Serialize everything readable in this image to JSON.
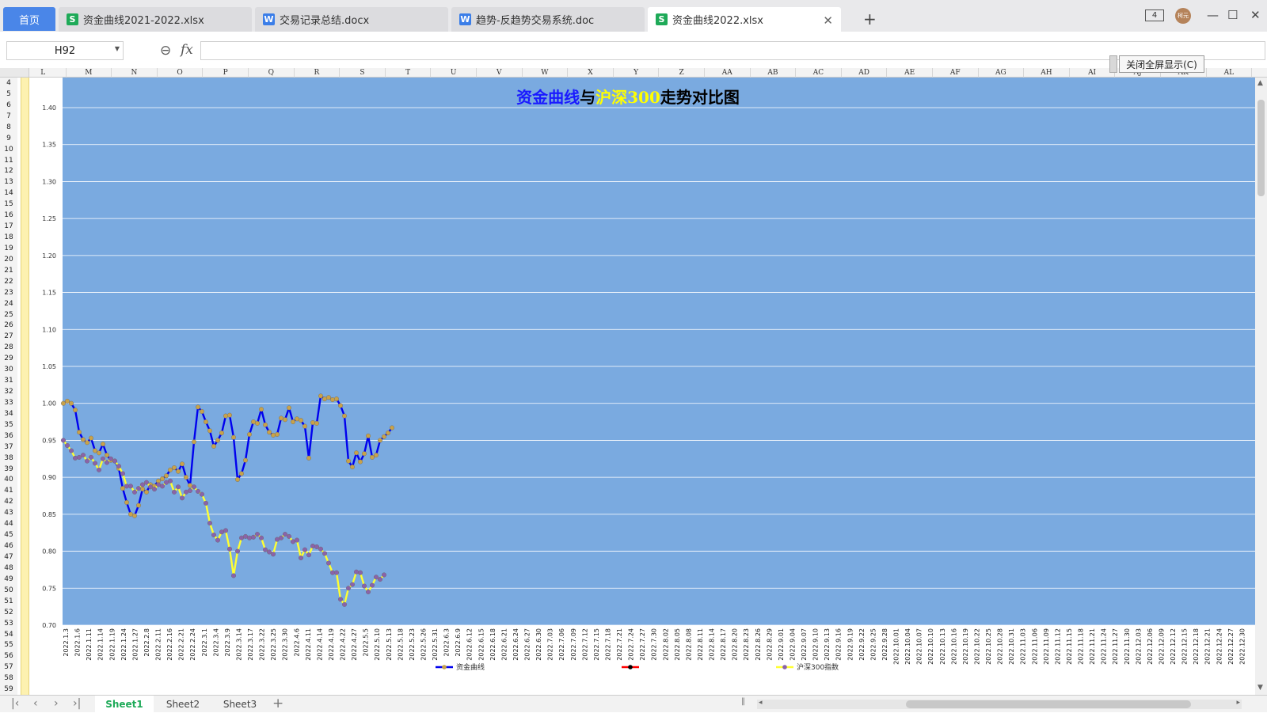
{
  "tabs": {
    "home": "首页",
    "files": [
      {
        "name": "资金曲线2021-2022.xlsx",
        "type": "S"
      },
      {
        "name": "交易记录总结.docx",
        "type": "W"
      },
      {
        "name": "趋势-反趋势交易系统.doc",
        "type": "W"
      },
      {
        "name": "资金曲线2022.xlsx",
        "type": "S"
      }
    ],
    "avatar": "柯元",
    "layout_badge": "4"
  },
  "formula_bar": {
    "cell_ref": "H92",
    "fx": "fx",
    "value": ""
  },
  "columns": [
    "L",
    "M",
    "N",
    "O",
    "P",
    "Q",
    "R",
    "S",
    "T",
    "U",
    "V",
    "W",
    "X",
    "Y",
    "Z",
    "AA",
    "AB",
    "AC",
    "AD",
    "AE",
    "AF",
    "AG",
    "AH",
    "AI",
    "AJ",
    "AK",
    "AL"
  ],
  "rows": [
    "4",
    "5",
    "6",
    "7",
    "8",
    "9",
    "10",
    "11",
    "12",
    "13",
    "14",
    "15",
    "16",
    "17",
    "18",
    "19",
    "20",
    "21",
    "22",
    "23",
    "24",
    "25",
    "26",
    "27",
    "28",
    "29",
    "30",
    "31",
    "32",
    "33",
    "34",
    "35",
    "36",
    "37",
    "38",
    "39",
    "40",
    "41",
    "42",
    "43",
    "44",
    "45",
    "46",
    "47",
    "48",
    "49",
    "50",
    "51",
    "52",
    "53",
    "54",
    "55",
    "56",
    "57",
    "58",
    "59"
  ],
  "fullscreen_button": "关闭全屏显示(C)",
  "sheets": [
    "Sheet1",
    "Sheet2",
    "Sheet3"
  ],
  "active_sheet": "Sheet1",
  "chart_data": {
    "type": "line",
    "title_parts": [
      {
        "text": "资金曲线",
        "color": "#1a1aff"
      },
      {
        "text": "与",
        "color": "#000000"
      },
      {
        "text": "沪深300",
        "color": "#ffff00"
      },
      {
        "text": "走势对比图",
        "color": "#000000"
      }
    ],
    "background": "#7aaae0",
    "ylim": [
      0.7,
      1.4
    ],
    "yticks": [
      "0.70",
      "0.75",
      "0.80",
      "0.85",
      "0.90",
      "0.95",
      "1.00",
      "1.05",
      "1.10",
      "1.15",
      "1.20",
      "1.25",
      "1.30",
      "1.35",
      "1.40"
    ],
    "grid": "horizontal",
    "legend_position": "bottom",
    "categories": [
      "2022.1.3",
      "2022.1.6",
      "2022.1.11",
      "2022.1.14",
      "2022.1.19",
      "2022.1.24",
      "2022.1.27",
      "2022.2.8",
      "2022.2.11",
      "2022.2.16",
      "2022.2.21",
      "2022.2.24",
      "2022.3.1",
      "2022.3.4",
      "2022.3.9",
      "2022.3.14",
      "2022.3.17",
      "2022.3.22",
      "2022.3.25",
      "2022.3.30",
      "2022.4.6",
      "2022.4.11",
      "2022.4.14",
      "2022.4.19",
      "2022.4.22",
      "2022.4.27",
      "2022.5.5",
      "2022.5.10",
      "2022.5.13",
      "2022.5.18",
      "2022.5.23",
      "2022.5.26",
      "2022.5.31",
      "2022.6.3",
      "2022.6.9",
      "2022.6.12",
      "2022.6.15",
      "2022.6.18",
      "2022.6.21",
      "2022.6.24",
      "2022.6.27",
      "2022.6.30",
      "2022.7.03",
      "2022.7.06",
      "2022.7.09",
      "2022.7.12",
      "2022.7.15",
      "2022.7.18",
      "2022.7.21",
      "2022.7.24",
      "2022.7.27",
      "2022.7.30",
      "2022.8.02",
      "2022.8.05",
      "2022.8.08",
      "2022.8.11",
      "2022.8.14",
      "2022.8.17",
      "2022.8.20",
      "2022.8.23",
      "2022.8.26",
      "2022.8.29",
      "2022.9.01",
      "2022.9.04",
      "2022.9.07",
      "2022.9.10",
      "2022.9.13",
      "2022.9.16",
      "2022.9.19",
      "2022.9.22",
      "2022.9.25",
      "2022.9.28",
      "2022.10.01",
      "2022.10.04",
      "2022.10.07",
      "2022.10.10",
      "2022.10.13",
      "2022.10.16",
      "2022.10.19",
      "2022.10.22",
      "2022.10.25",
      "2022.10.28",
      "2022.10.31",
      "2022.11.03",
      "2022.11.06",
      "2022.11.09",
      "2022.11.12",
      "2022.11.15",
      "2022.11.18",
      "2022.11.21",
      "2022.11.24",
      "2022.11.27",
      "2022.11.30",
      "2022.12.03",
      "2022.12.06",
      "2022.12.09",
      "2022.12.12",
      "2022.12.15",
      "2022.12.18",
      "2022.12.21",
      "2022.12.24",
      "2022.12.27",
      "2022.12.30"
    ],
    "series": [
      {
        "name": "资金曲线",
        "line_color": "#0000ee",
        "marker_color": "#c8a24a",
        "values": [
          1.0,
          1.003,
          1.0,
          0.991,
          0.961,
          0.951,
          0.947,
          0.953,
          0.936,
          0.933,
          0.945,
          0.93,
          0.923,
          0.922,
          0.912,
          0.885,
          0.866,
          0.85,
          0.848,
          0.862,
          0.884,
          0.88,
          0.89,
          0.888,
          0.895,
          0.898,
          0.902,
          0.91,
          0.913,
          0.908,
          0.918,
          0.9,
          0.889,
          0.948,
          0.995,
          0.989,
          0.975,
          0.963,
          0.942,
          0.95,
          0.96,
          0.983,
          0.984,
          0.954,
          0.897,
          0.905,
          0.923,
          0.958,
          0.975,
          0.973,
          0.992,
          0.971,
          0.961,
          0.957,
          0.958,
          0.98,
          0.978,
          0.994,
          0.975,
          0.979,
          0.977,
          0.969,
          0.926,
          0.974,
          0.973,
          1.01,
          1.006,
          1.008,
          1.005,
          1.006,
          0.997,
          0.983,
          0.922,
          0.914,
          0.933,
          0.921,
          0.932,
          0.956,
          0.927,
          0.93,
          0.95,
          0.955,
          0.96,
          0.967
        ]
      },
      {
        "name": "",
        "line_color": "#ff0000",
        "marker_color": "#000000",
        "values": []
      },
      {
        "name": "沪深300指数",
        "line_color": "#ffff33",
        "marker_color": "#8a63a8",
        "values": [
          0.95,
          0.943,
          0.936,
          0.926,
          0.927,
          0.93,
          0.922,
          0.927,
          0.919,
          0.91,
          0.925,
          0.92,
          0.925,
          0.922,
          0.915,
          0.905,
          0.888,
          0.888,
          0.88,
          0.885,
          0.89,
          0.893,
          0.887,
          0.884,
          0.89,
          0.888,
          0.893,
          0.895,
          0.88,
          0.887,
          0.872,
          0.88,
          0.882,
          0.887,
          0.881,
          0.877,
          0.865,
          0.838,
          0.822,
          0.815,
          0.826,
          0.828,
          0.803,
          0.767,
          0.8,
          0.818,
          0.82,
          0.818,
          0.819,
          0.823,
          0.818,
          0.802,
          0.799,
          0.796,
          0.816,
          0.818,
          0.823,
          0.82,
          0.813,
          0.815,
          0.791,
          0.802,
          0.795,
          0.807,
          0.806,
          0.803,
          0.797,
          0.784,
          0.771,
          0.771,
          0.735,
          0.728,
          0.75,
          0.755,
          0.772,
          0.771,
          0.753,
          0.745,
          0.754,
          0.765,
          0.762,
          0.768
        ]
      }
    ]
  }
}
